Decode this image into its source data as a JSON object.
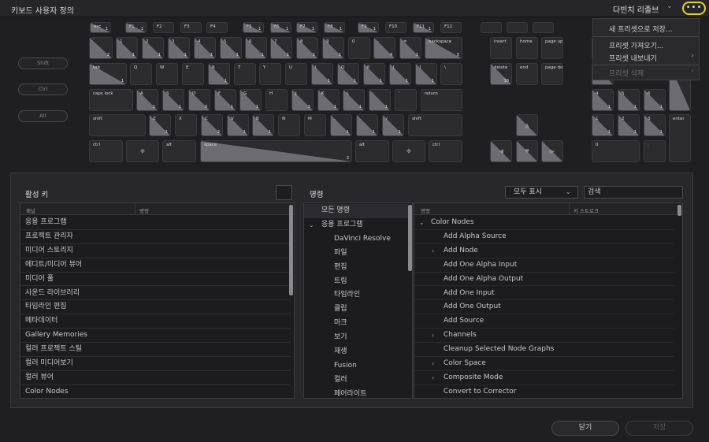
{
  "titlebar": {
    "title": "키보드 사용자 정의",
    "preset": "다빈치 리졸브",
    "more": "•••"
  },
  "modifiers": {
    "shift": "Shift",
    "ctrl": "Ctrl",
    "alt": "Alt"
  },
  "keys": {
    "esc": "esc",
    "f1": "F1",
    "f2": "F2",
    "f3": "F3",
    "f4": "F4",
    "f5": "F5",
    "f6": "F6",
    "f7": "F7",
    "f8": "F8",
    "f9": "F9",
    "f10": "F10",
    "f11": "F11",
    "f12": "F12",
    "backtick": "`",
    "n1": "1",
    "n2": "2",
    "n3": "3",
    "n4": "4",
    "n5": "5",
    "n6": "6",
    "n7": "7",
    "n8": "8",
    "n9": "9",
    "n0": "0",
    "minus": "-",
    "equal": "=",
    "backspace": "backspace",
    "tab": "tab",
    "q": "Q",
    "w": "W",
    "e": "E",
    "r": "R",
    "t": "T",
    "y": "Y",
    "u": "U",
    "i": "I",
    "o": "O",
    "p": "P",
    "lbr": "[",
    "rbr": "]",
    "bslash": "\\",
    "capslock": "caps lock",
    "a": "A",
    "s": "S",
    "d": "D",
    "f": "F",
    "g": "G",
    "h": "H",
    "j": "J",
    "k": "K",
    "l": "L",
    "semi": ";",
    "quote": "'",
    "return": "return",
    "lshift": "shift",
    "z": "Z",
    "x": "X",
    "c": "C",
    "v": "V",
    "b": "B",
    "n": "N",
    "m": "M",
    "comma": ",",
    "period": ".",
    "slash": "/",
    "rshift": "shift",
    "lctrl": "ctrl",
    "lalt": "alt",
    "space": "space",
    "ralt": "alt",
    "rctrl": "ctrl",
    "insert": "insert",
    "home": "home",
    "pageup": "page up",
    "delete": "delete",
    "end": "end",
    "pagedown": "page down",
    "np4": "4",
    "np5": "5",
    "np6": "6",
    "np1": "1",
    "np2": "2",
    "np3": "3",
    "np0": "0",
    "npdot": ".",
    "enter": "enter"
  },
  "key_counts": {
    "c1": "1",
    "c2": "2",
    "c3": "3",
    "c4": "4",
    "c5": "5",
    "c10": "10"
  },
  "dropdown": {
    "items": [
      "새 프리셋으로 저장...",
      "프리셋 가져오기...",
      "프리셋 내보내기",
      "프리셋 삭제"
    ]
  },
  "active_keys": {
    "header": "활성 키",
    "col_panel": "패널",
    "col_command": "명령",
    "rows": [
      "응용 프로그램",
      "프로젝트 관리자",
      "미디어 스토리지",
      "에디트/미디어 뷰어",
      "미디어 풀",
      "사운드 라이브러리",
      "타임라인 편집",
      "메타데이터",
      "Gallery Memories",
      "컬러 프로젝트 스틸",
      "컬러 미디어보기",
      "컬러 뷰어",
      "Color Nodes"
    ]
  },
  "commands": {
    "header": "명령",
    "filter": "모두 표시",
    "search_placeholder": "검색",
    "categories": [
      "모든 명령",
      "응용 프로그램",
      "DaVinci Resolve",
      "파일",
      "편집",
      "트림",
      "타임라인",
      "클립",
      "마크",
      "보기",
      "재생",
      "Fusion",
      "컬러",
      "페어라이트"
    ],
    "col_command": "명령",
    "col_keystroke": "키 스트로크",
    "rows": [
      "Color Nodes",
      "Add Alpha Source",
      "Add Node",
      "Add One Alpha Input",
      "Add One Alpha Output",
      "Add One Input",
      "Add One Output",
      "Add Source",
      "Channels",
      "Cleanup Selected Node Graphs",
      "Color Space",
      "Composite Mode",
      "Convert to Corrector"
    ]
  },
  "footer": {
    "close": "닫기",
    "save": "저장"
  }
}
